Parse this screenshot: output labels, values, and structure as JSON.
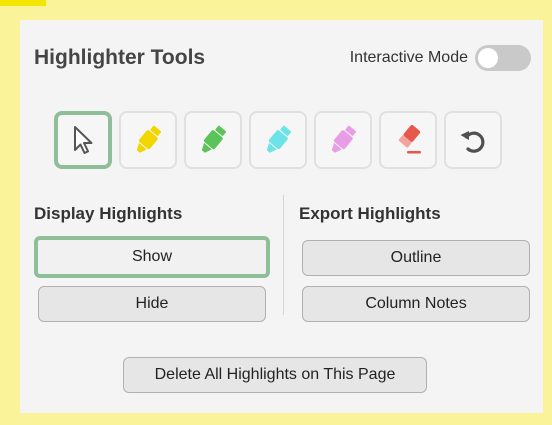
{
  "header": {
    "title": "Highlighter Tools",
    "interactive_mode_label": "Interactive Mode",
    "interactive_mode_on": false
  },
  "tools": [
    {
      "name": "select-cursor-icon",
      "color": "#555555",
      "selected": true
    },
    {
      "name": "yellow-highlighter-icon",
      "color": "#f2d600"
    },
    {
      "name": "green-highlighter-icon",
      "color": "#5cc35a"
    },
    {
      "name": "cyan-highlighter-icon",
      "color": "#6ce3e6"
    },
    {
      "name": "pink-highlighter-icon",
      "color": "#e79ee6"
    },
    {
      "name": "eraser-icon",
      "color": "#e8574c"
    },
    {
      "name": "undo-icon",
      "color": "#505050"
    }
  ],
  "display": {
    "title": "Display Highlights",
    "show_label": "Show",
    "hide_label": "Hide"
  },
  "export": {
    "title": "Export Highlights",
    "outline_label": "Outline",
    "column_notes_label": "Column Notes"
  },
  "delete_all_label": "Delete All Highlights on This Page",
  "colors": {
    "frame": "#fbf39a",
    "panel": "#f4f4f4",
    "active_border": "#8fbf98"
  }
}
